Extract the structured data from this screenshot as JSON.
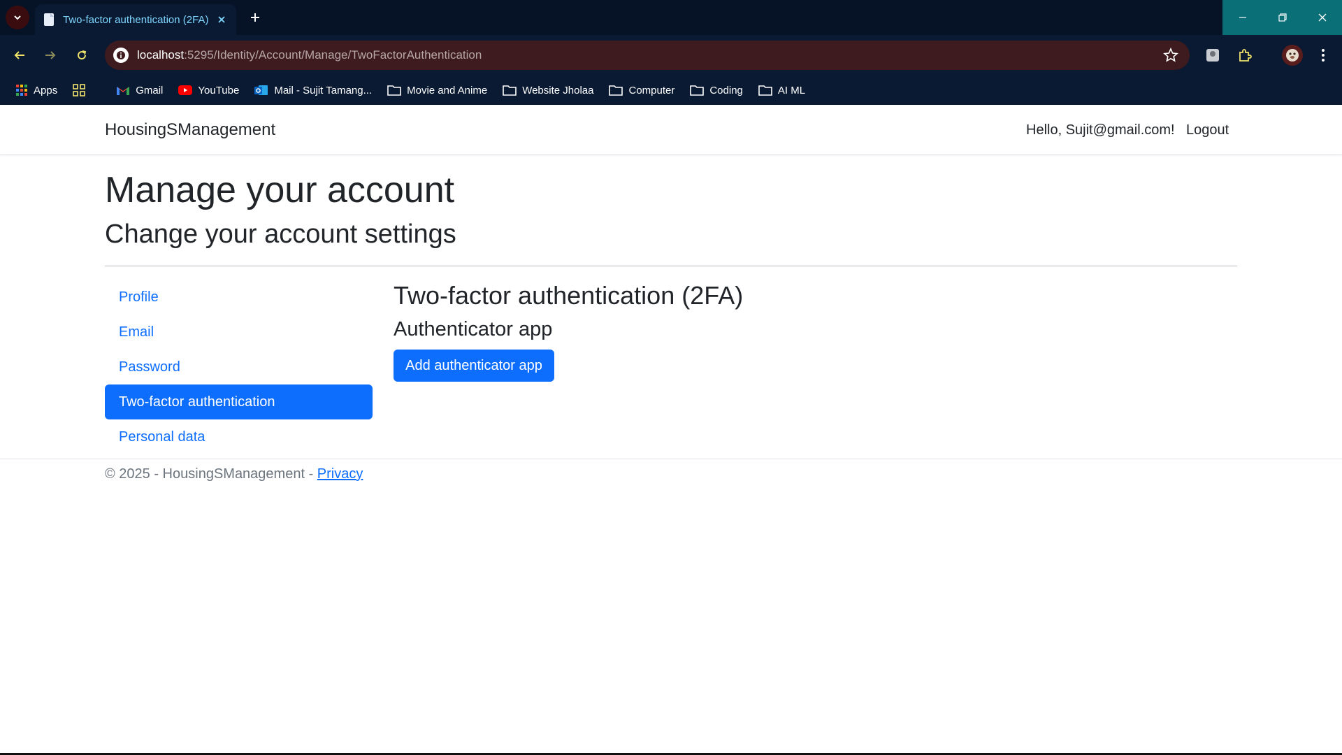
{
  "browser": {
    "tab_title": "Two-factor authentication (2FA)",
    "url_host": "localhost",
    "url_rest": ":5295/Identity/Account/Manage/TwoFactorAuthentication",
    "bookmarks": [
      {
        "label": "Apps",
        "icon": "apps-grid-icon"
      },
      {
        "label": "",
        "icon": "grid-icon"
      },
      {
        "label": "Gmail",
        "icon": "gmail-icon"
      },
      {
        "label": "YouTube",
        "icon": "youtube-icon"
      },
      {
        "label": "Mail - Sujit Tamang...",
        "icon": "outlook-icon"
      },
      {
        "label": "Movie and Anime",
        "icon": "folder-icon"
      },
      {
        "label": "Website Jholaa",
        "icon": "folder-icon"
      },
      {
        "label": "Computer",
        "icon": "folder-icon"
      },
      {
        "label": "Coding",
        "icon": "folder-icon"
      },
      {
        "label": "AI ML",
        "icon": "folder-icon"
      }
    ]
  },
  "navbar": {
    "brand": "HousingSManagement",
    "greeting": "Hello, Sujit@gmail.com!",
    "logout": "Logout"
  },
  "header": {
    "title": "Manage your account",
    "subtitle": "Change your account settings"
  },
  "sidenav": {
    "items": [
      {
        "label": "Profile"
      },
      {
        "label": "Email"
      },
      {
        "label": "Password"
      },
      {
        "label": "Two-factor authentication"
      },
      {
        "label": "Personal data"
      }
    ]
  },
  "content": {
    "title": "Two-factor authentication (2FA)",
    "subtitle": "Authenticator app",
    "button": "Add authenticator app"
  },
  "footer": {
    "text": "© 2025 - HousingSManagement - ",
    "privacy": "Privacy"
  },
  "colors": {
    "primary": "#0d6efd",
    "chrome_bg": "#0a1a33"
  }
}
